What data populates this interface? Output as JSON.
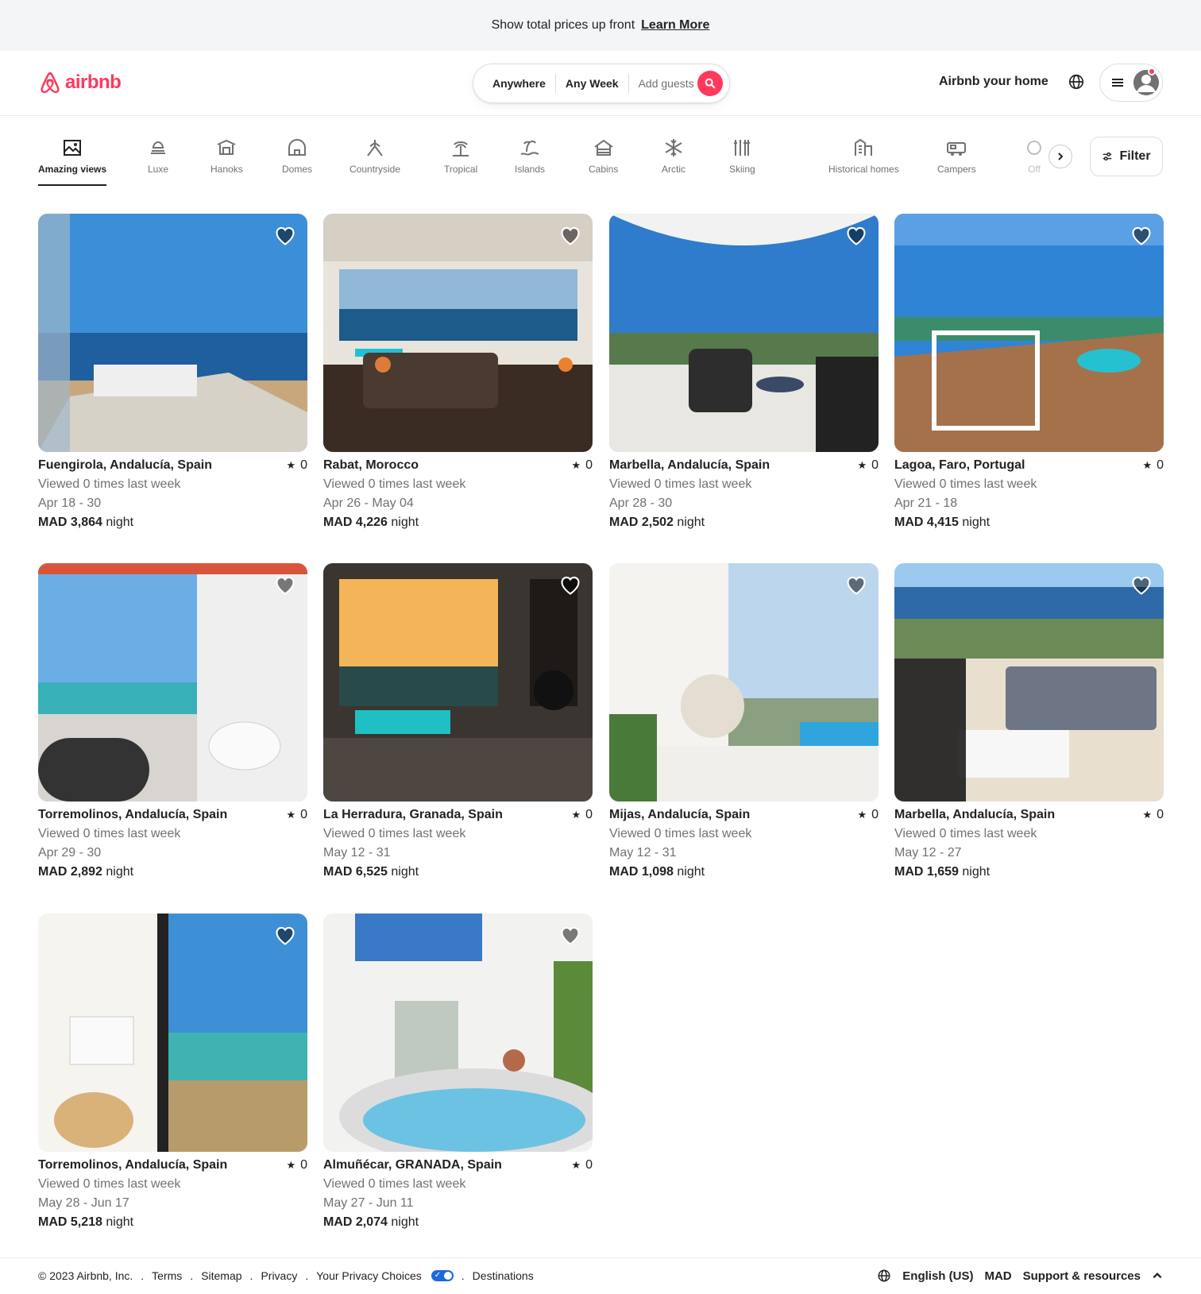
{
  "banner": {
    "text": "Show total prices up front",
    "link": "Learn More"
  },
  "header": {
    "logo_text": "airbnb",
    "search": {
      "where": "Anywhere",
      "when": "Any Week",
      "who": "Add guests"
    },
    "host_link": "Airbnb your home"
  },
  "categories": [
    {
      "label": "Amazing views",
      "icon": "amazing-views-icon",
      "active": true
    },
    {
      "label": "Luxe",
      "icon": "luxe-icon"
    },
    {
      "label": "Hanoks",
      "icon": "hanoks-icon"
    },
    {
      "label": "Domes",
      "icon": "domes-icon"
    },
    {
      "label": "Countryside",
      "icon": "countryside-icon"
    },
    {
      "label": "Tropical",
      "icon": "tropical-icon"
    },
    {
      "label": "Islands",
      "icon": "islands-icon"
    },
    {
      "label": "Cabins",
      "icon": "cabins-icon"
    },
    {
      "label": "Arctic",
      "icon": "arctic-icon"
    },
    {
      "label": "Skiing",
      "icon": "skiing-icon"
    },
    {
      "label": "Historical homes",
      "icon": "historical-homes-icon"
    },
    {
      "label": "Campers",
      "icon": "campers-icon"
    },
    {
      "label": "Off",
      "icon": "offgrid-icon"
    }
  ],
  "filter_label": "Filter",
  "listings": [
    {
      "location": "Fuengirola, Andalucía, Spain",
      "rating": "0",
      "views": "Viewed 0 times last week",
      "dates": "Apr 18 - 30",
      "price": "MAD 3,864",
      "unit": "night",
      "scene": "terrace-sea"
    },
    {
      "location": "Rabat, Morocco",
      "rating": "0",
      "views": "Viewed 0 times last week",
      "dates": "Apr 26 - May 04",
      "price": "MAD 4,226",
      "unit": "night",
      "scene": "pool-living"
    },
    {
      "location": "Marbella, Andalucía, Spain",
      "rating": "0",
      "views": "Viewed 0 times last week",
      "dates": "Apr 28 - 30",
      "price": "MAD 2,502",
      "unit": "night",
      "scene": "patio-chairs"
    },
    {
      "location": "Lagoa, Faro, Portugal",
      "rating": "0",
      "views": "Viewed 0 times last week",
      "dates": "Apr 21 - 18",
      "price": "MAD 4,415",
      "unit": "night",
      "scene": "deck-pool"
    },
    {
      "location": "Torremolinos, Andalucía, Spain",
      "rating": "0",
      "views": "Viewed 0 times last week",
      "dates": "Apr 29 - 30",
      "price": "MAD 2,892",
      "unit": "night",
      "scene": "balcony-jacuzzi"
    },
    {
      "location": "La Herradura, Granada, Spain",
      "rating": "0",
      "views": "Viewed 0 times last week",
      "dates": "May 12 - 31",
      "price": "MAD 6,525",
      "unit": "night",
      "scene": "sunset-window"
    },
    {
      "location": "Mijas, Andalucía, Spain",
      "rating": "0",
      "views": "Viewed 0 times last week",
      "dates": "May 12 - 31",
      "price": "MAD 1,098",
      "unit": "night",
      "scene": "hanging-chair"
    },
    {
      "location": "Marbella, Andalucía, Spain",
      "rating": "0",
      "views": "Viewed 0 times last week",
      "dates": "May 12 - 27",
      "price": "MAD 1,659",
      "unit": "night",
      "scene": "balcony-sofa"
    },
    {
      "location": "Torremolinos, Andalucía, Spain",
      "rating": "0",
      "views": "Viewed 0 times last week",
      "dates": "May 28 - Jun 17",
      "price": "MAD 5,218",
      "unit": "night",
      "scene": "interior-balcony"
    },
    {
      "location": "Almuñécar, GRANADA, Spain",
      "rating": "0",
      "views": "Viewed 0 times last week",
      "dates": "May 27 - Jun 11",
      "price": "MAD 2,074",
      "unit": "night",
      "scene": "white-jacuzzi"
    }
  ],
  "footer": {
    "copyright": "© 2023 Airbnb, Inc.",
    "links": [
      "Terms",
      "Sitemap",
      "Privacy",
      "Your Privacy Choices",
      "Destinations"
    ],
    "language": "English (US)",
    "currency": "MAD",
    "support": "Support & resources"
  },
  "colors": {
    "brand": "#ff385c",
    "text": "#222222",
    "muted": "#717171"
  }
}
